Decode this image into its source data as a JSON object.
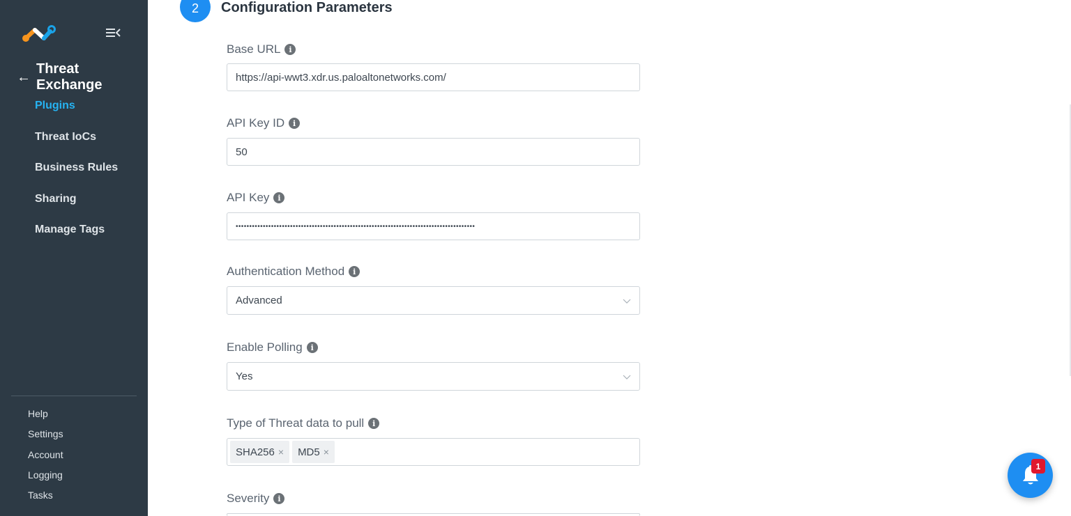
{
  "sidebar": {
    "section_title": "Threat Exchange",
    "nav_items": [
      {
        "label": "Plugins",
        "active": true
      },
      {
        "label": "Threat IoCs",
        "active": false
      },
      {
        "label": "Business Rules",
        "active": false
      },
      {
        "label": "Sharing",
        "active": false
      },
      {
        "label": "Manage Tags",
        "active": false
      }
    ],
    "footer_items": [
      "Help",
      "Settings",
      "Account",
      "Logging",
      "Tasks"
    ]
  },
  "main": {
    "step_number": "2",
    "section_title": "Configuration Parameters",
    "fields": {
      "base_url": {
        "label": "Base URL",
        "value": "https://api-wwt3.xdr.us.paloaltonetworks.com/"
      },
      "api_key_id": {
        "label": "API Key ID",
        "value": "50"
      },
      "api_key": {
        "label": "API Key",
        "value": "••••••••••••••••••••••••••••••••••••••••••••••••••••••••••••••••••••••••••••••••••••••••"
      },
      "auth_method": {
        "label": "Authentication Method",
        "value": "Advanced"
      },
      "enable_polling": {
        "label": "Enable Polling",
        "value": "Yes"
      },
      "threat_types": {
        "label": "Type of Threat data to pull",
        "tags": [
          "SHA256",
          "MD5"
        ]
      },
      "severity": {
        "label": "Severity"
      }
    }
  },
  "notifications": {
    "count": "1"
  },
  "colors": {
    "sidebar_bg": "#2d3a45",
    "accent": "#1e8ef2",
    "active_nav": "#26b3f2",
    "badge": "#e0182d"
  }
}
